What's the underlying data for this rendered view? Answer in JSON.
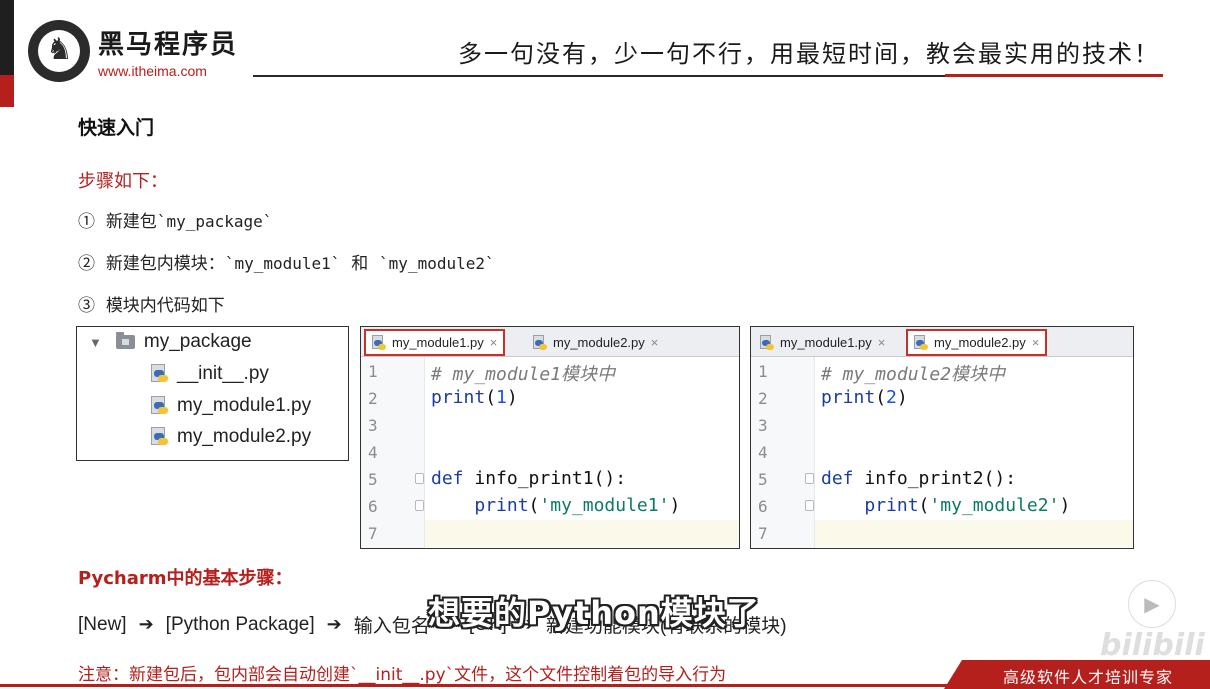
{
  "brand": {
    "name_cn": "黑马程序员",
    "url": "www.itheima.com",
    "slogan": "多一句没有，少一句不行，用最短时间，教会最实用的技术！"
  },
  "slide": {
    "title": "快速入门",
    "steps_heading": "步骤如下：",
    "steps": [
      {
        "num": "①",
        "text": "新建包",
        "code": "`my_package`"
      },
      {
        "num": "②",
        "text": "新建包内模块：",
        "code1": "`my_module1`",
        "join": "和",
        "code2": "`my_module2`"
      },
      {
        "num": "③",
        "text": "模块内代码如下"
      }
    ],
    "tree": {
      "folder": "my_package",
      "files": [
        "__init__.py",
        "my_module1.py",
        "my_module2.py"
      ]
    },
    "editor1": {
      "tabs": [
        {
          "label": "my_module1.py",
          "close": "×"
        },
        {
          "label": "my_module2.py",
          "close": "×"
        }
      ],
      "line_numbers": [
        "1",
        "2",
        "3",
        "4",
        "5",
        "6",
        "7"
      ],
      "comment": "# my_module1模块中",
      "print_kw": "print",
      "print_arg": "1",
      "def_kw": "def",
      "def_name": "info_print1():",
      "inner_kw": "print",
      "inner_str": "'my_module1'"
    },
    "editor2": {
      "tabs": [
        {
          "label": "my_module1.py",
          "close": "×"
        },
        {
          "label": "my_module2.py",
          "close": "×"
        }
      ],
      "line_numbers": [
        "1",
        "2",
        "3",
        "4",
        "5",
        "6",
        "7"
      ],
      "comment": "# my_module2模块中",
      "print_kw": "print",
      "print_arg": "2",
      "def_kw": "def",
      "def_name": "info_print2():",
      "inner_kw": "print",
      "inner_str": "'my_module2'"
    },
    "pycharm_heading": "Pycharm中的基本步骤：",
    "flow": {
      "new": "[New]",
      "arrow": "➔",
      "package": "[Python Package]",
      "input": "输入包名",
      "ok": "[OK]",
      "create": "新建功能模块(有联系的模块)"
    },
    "note": "注意：新建包后，包内部会自动创建`__init__.py`文件，这个文件控制着包的导入行为"
  },
  "overlay": {
    "caption": "想要的Python模块了",
    "bilibili": "bilibili"
  },
  "footer": {
    "banner": "高级软件人才培训专家"
  }
}
